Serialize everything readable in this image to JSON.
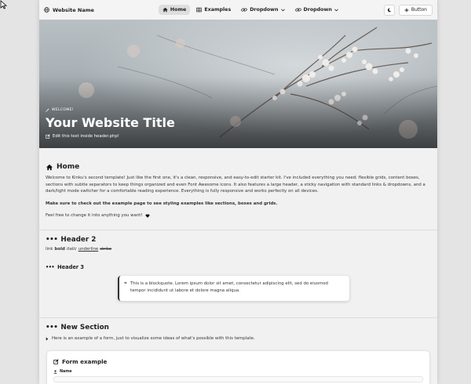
{
  "nav": {
    "brand": "Website Name",
    "links": [
      {
        "label": "Home",
        "icon": "home-icon",
        "active": true
      },
      {
        "label": "Examples",
        "icon": "table-icon",
        "active": false
      },
      {
        "label": "Dropdown",
        "icon": "link-icon",
        "active": false
      },
      {
        "label": "Dropdown",
        "icon": "link-icon",
        "active": false
      }
    ],
    "theme_toggle_icon": "moon-icon",
    "button_label": "Button"
  },
  "hero": {
    "welcome": "WELCOME!",
    "title": "Your Website Title",
    "subtitle": "Edit this text inside header.php!"
  },
  "home": {
    "title": "Home",
    "intro": "Welcome to Kinku's second template! Just like the first one, it's a clean, responsive, and easy-to-edit starter kit. I've included everything you need: flexible grids, content boxes, sections with subtle separators to keep things organized and even Font Awesome icons. It also features a large header, a sticky navigation with standard links & dropdowns, and a dark/light mode switcher for a comfortable reading experience. Everything is fully responsive and works perfectly on all devices.",
    "bold_note": "Make sure to check out the example page to see styling examples like sections, boxes and grids.",
    "feel_free": "Feel free to change it into anything you want!"
  },
  "header2": {
    "title": "Header 2",
    "link": "link",
    "bold": "bold",
    "italic": "italic",
    "underline": "underline",
    "strike": "strike"
  },
  "header3": {
    "title": "Header 3"
  },
  "blockquote": {
    "text": "This is a blockquote. Lorem ipsum dolor sit amet, consectetur adipiscing elit, sed do eiusmod tempor incididunt ut labore et dolore magna aliqua."
  },
  "new_section": {
    "title": "New Section",
    "desc": "Here is an example of a form, just to visualize some ideas of what's possible with this template."
  },
  "form": {
    "title": "Form example",
    "name_label": "Name"
  }
}
